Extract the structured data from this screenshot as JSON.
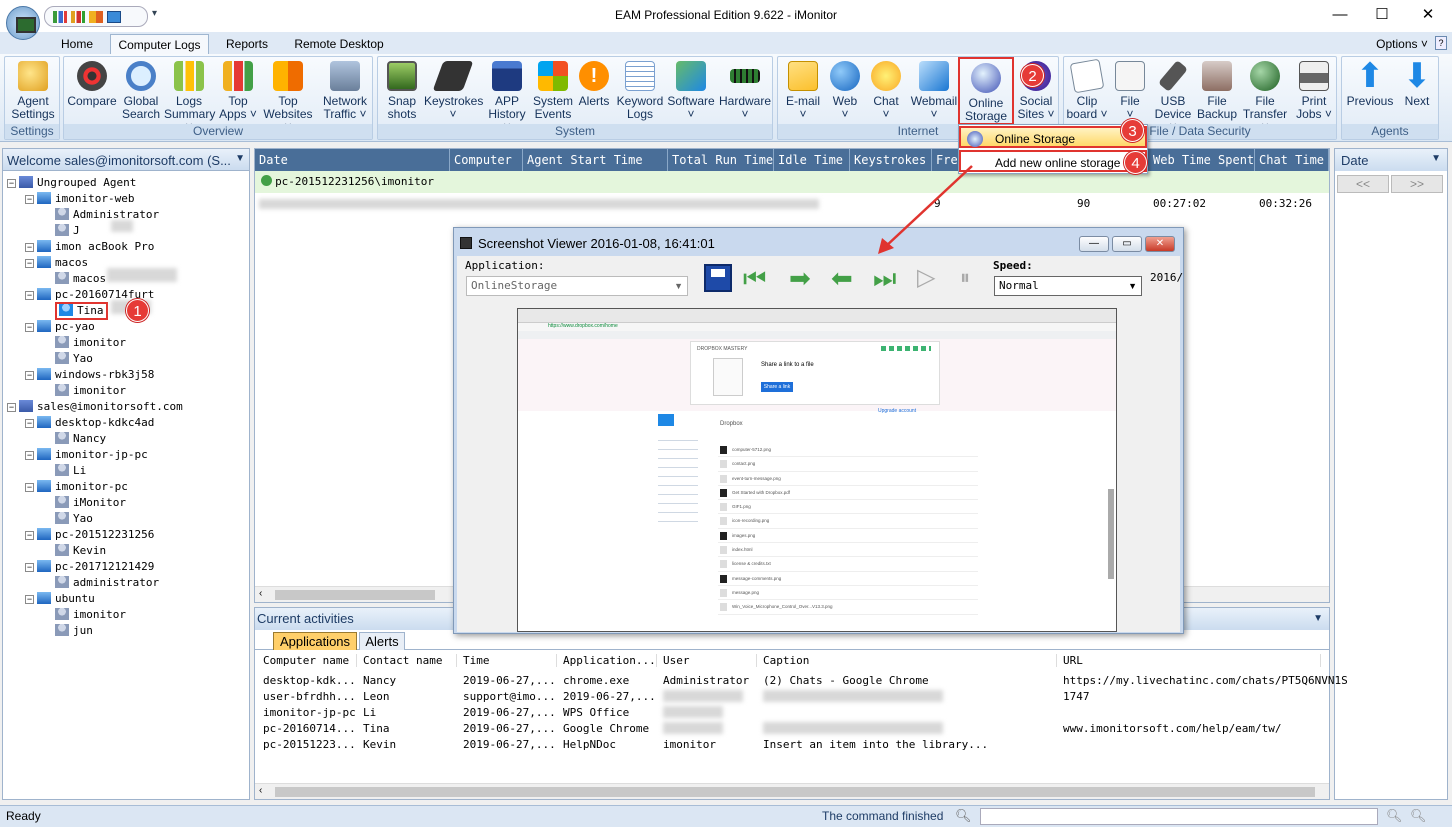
{
  "window": {
    "title": "EAM Professional Edition 9.622 - iMonitor",
    "minimize": "—",
    "maximize": "☐",
    "close": "✕"
  },
  "tabs": [
    "Home",
    "Computer Logs",
    "Reports",
    "Remote Desktop"
  ],
  "options": "Options ˅",
  "ribbon": {
    "groups": [
      "Settings",
      "Overview",
      "System",
      "Internet",
      "File / Data Security",
      "Agents"
    ],
    "buttons": {
      "agent_settings": [
        "Agent",
        "Settings"
      ],
      "compare": [
        "Compare",
        ""
      ],
      "global_search": [
        "Global",
        "Search"
      ],
      "logs_summary": [
        "Logs",
        "Summary ˅"
      ],
      "top_apps": [
        "Top",
        "Apps ˅"
      ],
      "top_websites": [
        "Top",
        "Websites ˅"
      ],
      "network_traffic": [
        "Network",
        "Traffic ˅"
      ],
      "snapshots": [
        "Snap",
        "shots"
      ],
      "keystrokes": [
        "Keystrokes",
        "˅"
      ],
      "app_history": [
        "APP",
        "History ˅"
      ],
      "system_events": [
        "System",
        "Events"
      ],
      "alerts": [
        "Alerts",
        ""
      ],
      "keyword_logs": [
        "Keyword",
        "Logs"
      ],
      "software": [
        "Software",
        "˅"
      ],
      "hardware": [
        "Hardware",
        "˅"
      ],
      "email": [
        "E-mail",
        "˅"
      ],
      "web": [
        "Web",
        "˅"
      ],
      "chat": [
        "Chat",
        "˅"
      ],
      "webmail": [
        "Webmail",
        "˅"
      ],
      "online_storage": [
        "Online",
        "Storage ˅"
      ],
      "social_sites": [
        "Social",
        "Sites ˅"
      ],
      "clipboard": [
        "Clip",
        "board ˅"
      ],
      "file": [
        "File",
        "˅"
      ],
      "usb_device": [
        "USB",
        "Device ˅"
      ],
      "file_backup": [
        "File",
        "Backup"
      ],
      "file_transfer": [
        "File",
        "Transfer ˅"
      ],
      "print_jobs": [
        "Print",
        "Jobs ˅"
      ],
      "previous": [
        "Previous",
        ""
      ],
      "next": [
        "Next",
        ""
      ]
    }
  },
  "dropdown": {
    "items": [
      "Online Storage",
      "Add new online storage"
    ]
  },
  "steps": [
    "1",
    "2",
    "3",
    "4"
  ],
  "left_panel": {
    "header": "Welcome sales@imonitorsoft.com (S...",
    "tree": [
      {
        "label": "Ungrouped Agent",
        "level": 0,
        "kind": "group"
      },
      {
        "label": "imonitor-web",
        "level": 1,
        "kind": "pc"
      },
      {
        "label": "Administrator",
        "level": 2,
        "kind": "user"
      },
      {
        "label": "J",
        "level": 2,
        "kind": "user"
      },
      {
        "label": "imon          acBook Pro",
        "level": 1,
        "kind": "pc"
      },
      {
        "label": "macos",
        "level": 1,
        "kind": "pc"
      },
      {
        "label": "macos",
        "level": 2,
        "kind": "user"
      },
      {
        "label": "pc-20160714furt",
        "level": 1,
        "kind": "pc"
      },
      {
        "label": "Tina",
        "level": 2,
        "kind": "user",
        "selected": true
      },
      {
        "label": "pc-yao",
        "level": 1,
        "kind": "pc"
      },
      {
        "label": "imonitor",
        "level": 2,
        "kind": "user"
      },
      {
        "label": "Yao",
        "level": 2,
        "kind": "user"
      },
      {
        "label": "windows-rbk3j58",
        "level": 1,
        "kind": "pc"
      },
      {
        "label": "imonitor",
        "level": 2,
        "kind": "user"
      },
      {
        "label": "sales@imonitorsoft.com",
        "level": 0,
        "kind": "group"
      },
      {
        "label": "desktop-kdkc4ad",
        "level": 1,
        "kind": "pc"
      },
      {
        "label": "Nancy",
        "level": 2,
        "kind": "user"
      },
      {
        "label": "imonitor-jp-pc",
        "level": 1,
        "kind": "pc"
      },
      {
        "label": "Li",
        "level": 2,
        "kind": "user"
      },
      {
        "label": "imonitor-pc",
        "level": 1,
        "kind": "pc"
      },
      {
        "label": "iMonitor",
        "level": 2,
        "kind": "user"
      },
      {
        "label": "Yao",
        "level": 2,
        "kind": "user"
      },
      {
        "label": "pc-201512231256",
        "level": 1,
        "kind": "pc"
      },
      {
        "label": "Kevin",
        "level": 2,
        "kind": "user"
      },
      {
        "label": "pc-201712121429",
        "level": 1,
        "kind": "pc"
      },
      {
        "label": "administrator",
        "level": 2,
        "kind": "user"
      },
      {
        "label": "ubuntu",
        "level": 1,
        "kind": "pc"
      },
      {
        "label": "imonitor",
        "level": 2,
        "kind": "user"
      },
      {
        "label": "jun",
        "level": 2,
        "kind": "user"
      }
    ]
  },
  "grid": {
    "columns": [
      "Date",
      "Computer",
      "Agent Start Time",
      "Total Run Time",
      "Idle Time",
      "Keystrokes",
      "Freq",
      "Web Time Spent",
      "Chat Time S"
    ],
    "group_row": "pc-201512231256\\imonitor",
    "row": {
      "freq": "9",
      "col_90": "90",
      "web_time": "00:27:02",
      "chat_time": "00:32:26"
    }
  },
  "right_panel": {
    "header": "Date",
    "prev": "<<",
    ">>": "",
    "next": ">>"
  },
  "viewer": {
    "title": "Screenshot Viewer 2016-01-08, 16:41:01",
    "application_label": "Application:",
    "application_value": "OnlineStorage",
    "speed_label": "Speed:",
    "speed_value": "Normal",
    "date_cut": "2016/",
    "shot": {
      "url": "https://www.dropbox.com/home",
      "banner": "DROPBOX MASTERY",
      "share_title": "Share a link to a file",
      "share_button": "Share a link",
      "folder": "Dropbox",
      "upgrade": "Upgrade account",
      "files": [
        "computer-5712.png",
        "contact.png",
        "event-turn-message.png",
        "Get Started with Dropbox.pdf",
        "GIF1.png",
        "icon-recording.png",
        "images.png",
        "index.html",
        "license & credits.txt",
        "message-comments.png",
        "message.png",
        "Win_Voice_Microphone_Control_Over...V13.3.png"
      ]
    }
  },
  "activities": {
    "title": "Current activities",
    "tabs": [
      "Applications",
      "Alerts"
    ],
    "columns": [
      "Computer name",
      "Contact name",
      "Time",
      "Application...",
      "User",
      "Caption",
      "URL"
    ],
    "rows": [
      [
        "desktop-kdk...",
        "Nancy",
        "2019-06-27,...",
        "chrome.exe",
        "Administrator",
        "(2) Chats - Google Chrome",
        "https://my.livechatinc.com/chats/PT5Q6NVN1S"
      ],
      [
        "user-bfrdhh...",
        "Leon",
        "support@imo...",
        "2019-06-27,...",
        "",
        "",
        "1747"
      ],
      [
        "imonitor-jp-pc",
        "Li",
        "2019-06-27,...",
        "WPS Office",
        "",
        "",
        ""
      ],
      [
        "pc-20160714...",
        "Tina",
        "2019-06-27,...",
        "Google Chrome",
        "",
        "",
        "www.imonitorsoft.com/help/eam/tw/"
      ],
      [
        "pc-20151223...",
        "Kevin",
        "2019-06-27,...",
        "HelpNDoc",
        "imonitor",
        "Insert an item into the library...",
        ""
      ]
    ]
  },
  "status": {
    "left": "Ready",
    "command": "The command finished"
  },
  "colors": {
    "accent_red": "#e63b37",
    "header_blue": "#496e98",
    "ribbon_bg": "#dbe7f4",
    "group_row_green": "#e4f6dc"
  }
}
